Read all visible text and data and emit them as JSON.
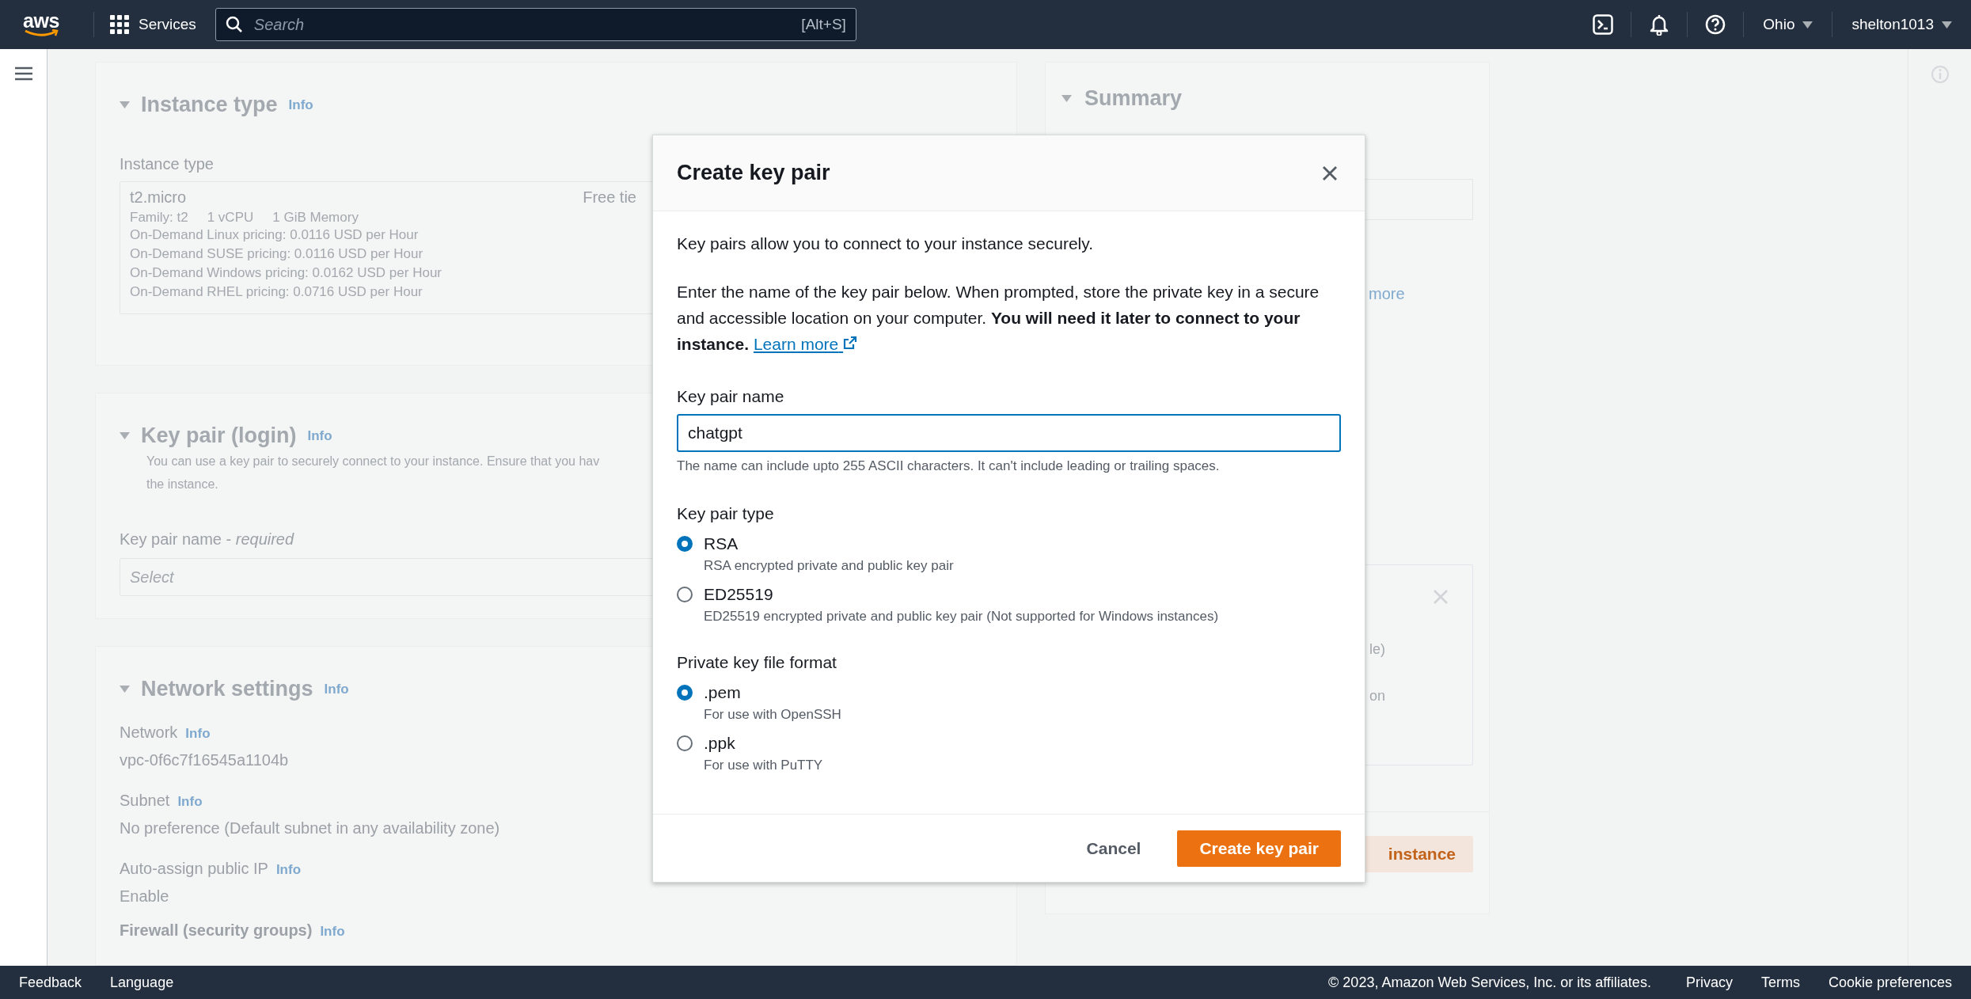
{
  "top_nav": {
    "logo": "aws",
    "services": "Services",
    "search": {
      "placeholder": "Search",
      "shortcut": "[Alt+S]"
    },
    "region": "Ohio",
    "account": "shelton1013"
  },
  "sections": [
    {
      "title": "Instance type",
      "info": "Info",
      "items": [
        {
          "kind": "label",
          "text": "Instance type"
        },
        {
          "kind": "instance_box",
          "name": "t2.micro",
          "badge": "Free tie",
          "specs": [
            "Family: t2",
            "1 vCPU",
            "1 GiB Memory"
          ],
          "lines": [
            "On-Demand Linux pricing: 0.0116 USD per Hour",
            "On-Demand SUSE pricing: 0.0116 USD per Hour",
            "On-Demand Windows pricing: 0.0162 USD per Hour",
            "On-Demand RHEL pricing: 0.0716 USD per Hour"
          ]
        }
      ]
    },
    {
      "title": "Key pair (login)",
      "info": "Info",
      "items": [
        {
          "kind": "description",
          "lines": [
            "You can use a key pair to securely connect to your instance. Ensure that you hav",
            "the instance."
          ]
        },
        {
          "kind": "label",
          "text": "Key pair name - *required*"
        },
        {
          "kind": "select",
          "placeholder": "Select"
        }
      ]
    },
    {
      "title": "Network settings",
      "info": "Info",
      "items": [
        {
          "kind": "label",
          "text": "Network",
          "info": "Info"
        },
        {
          "kind": "value",
          "text": "vpc-0f6c7f16545a1104b"
        },
        {
          "kind": "label",
          "text": "Subnet",
          "info": "Info"
        },
        {
          "kind": "value",
          "text": "No preference (Default subnet in any availability zone)"
        },
        {
          "kind": "label",
          "text": "Auto-assign public IP",
          "info": "Info"
        },
        {
          "kind": "value",
          "text": "Enable"
        },
        {
          "kind": "strong_label",
          "text": "Firewall (security groups)",
          "info": "Info"
        }
      ]
    }
  ],
  "summary": {
    "title": "Summary",
    "link": "more",
    "card_lines": [
      "le)",
      "on"
    ],
    "button": "instance"
  },
  "modal": {
    "title": "Create key pair",
    "intro": "Key pairs allow you to connect to your instance securely.",
    "body": "Enter the name of the key pair below. When prompted, store the private key in a secure and accessible location on your computer. **You will need it later to connect to your instance.**",
    "link": "Learn more",
    "name_label": "Key pair name",
    "name_value": "chatgpt",
    "name_hint": "The name can include upto 255 ASCII characters. It can't include leading or trailing spaces.",
    "radio_groups": [
      {
        "label": "Key pair type",
        "options": [
          {
            "label": "RSA",
            "description": "RSA encrypted private and public key pair",
            "selected": true
          },
          {
            "label": "ED25519",
            "description": "ED25519 encrypted private and public key pair (Not supported for Windows instances)",
            "selected": false
          }
        ]
      },
      {
        "label": "Private key file format",
        "options": [
          {
            "label": ".pem",
            "description": "For use with OpenSSH",
            "selected": true
          },
          {
            "label": ".ppk",
            "description": "For use with PuTTY",
            "selected": false
          }
        ]
      }
    ],
    "cancel": "Cancel",
    "submit": "Create key pair"
  },
  "footer": {
    "left": [
      "Feedback",
      "Language"
    ],
    "copyright": "© 2023, Amazon Web Services, Inc. or its affiliates.",
    "right": [
      "Privacy",
      "Terms",
      "Cookie preferences"
    ]
  }
}
